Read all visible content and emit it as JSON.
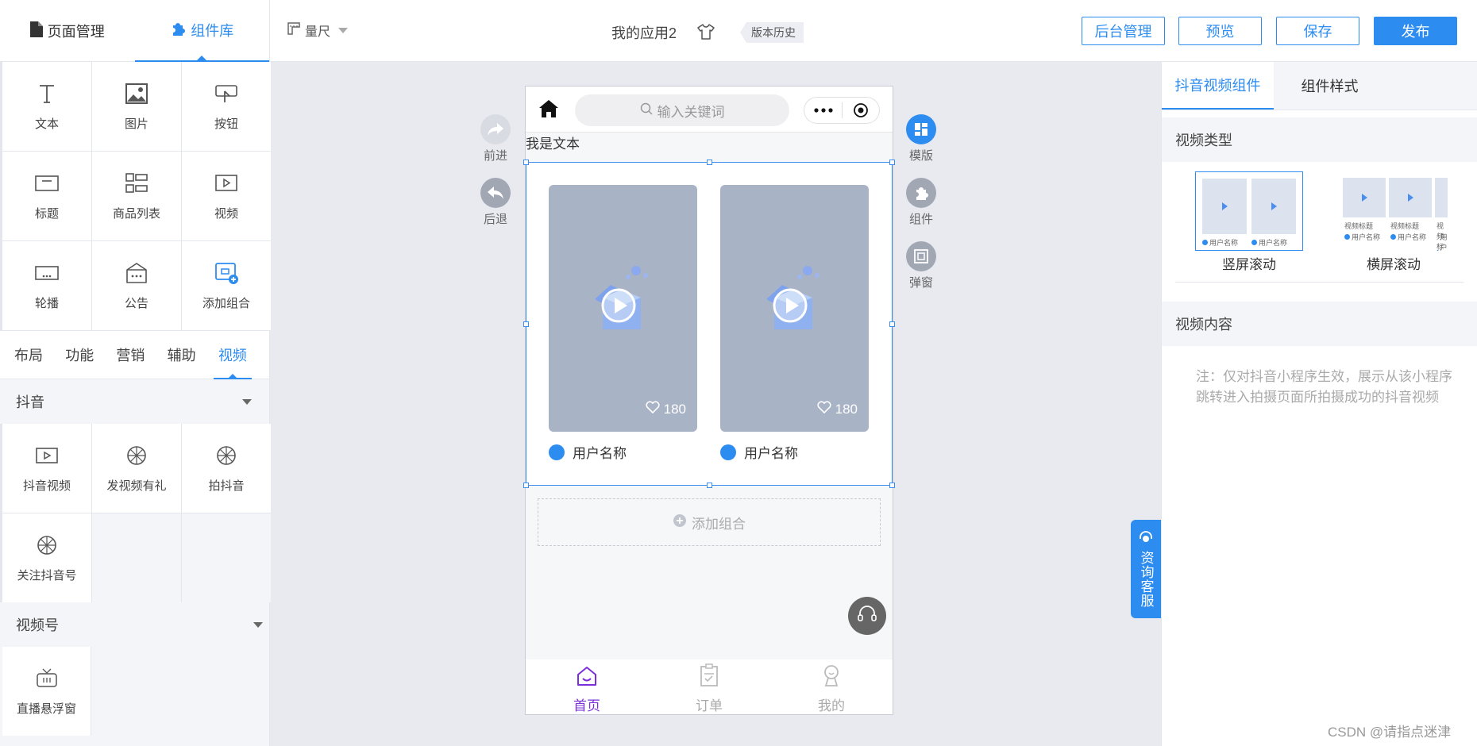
{
  "header": {
    "tabs": [
      {
        "label": "页面管理",
        "icon": "file-icon",
        "active": false
      },
      {
        "label": "组件库",
        "icon": "puzzle-icon",
        "active": true
      }
    ],
    "ruler_label": "量尺",
    "app_title": "我的应用2",
    "version_history": "版本历史",
    "buttons": {
      "admin": "后台管理",
      "preview": "预览",
      "save": "保存",
      "publish": "发布"
    },
    "accent_color": "#2d8cf0"
  },
  "components": {
    "grid": [
      {
        "label": "文本",
        "icon": "text-icon"
      },
      {
        "label": "图片",
        "icon": "image-icon"
      },
      {
        "label": "按钮",
        "icon": "button-icon"
      },
      {
        "label": "标题",
        "icon": "title-icon"
      },
      {
        "label": "商品列表",
        "icon": "product-list-icon"
      },
      {
        "label": "视频",
        "icon": "video-icon"
      },
      {
        "label": "轮播",
        "icon": "carousel-icon"
      },
      {
        "label": "公告",
        "icon": "notice-icon"
      },
      {
        "label": "添加组合",
        "icon": "add-combo-icon"
      }
    ],
    "categories": [
      "布局",
      "功能",
      "营销",
      "辅助",
      "视频"
    ],
    "active_category": "视频",
    "douyin": {
      "title": "抖音",
      "items": [
        {
          "label": "抖音视频",
          "icon": "video-icon"
        },
        {
          "label": "发视频有礼",
          "icon": "aperture-icon"
        },
        {
          "label": "拍抖音",
          "icon": "aperture-icon"
        },
        {
          "label": "关注抖音号",
          "icon": "aperture-icon"
        }
      ]
    },
    "channels": {
      "title": "视频号",
      "items": [
        {
          "label": "直播悬浮窗",
          "icon": "tv-icon"
        }
      ]
    }
  },
  "canvas": {
    "left_actions": {
      "forward": "前进",
      "back": "后退"
    },
    "right_actions": {
      "template": "模版",
      "component": "组件",
      "popup": "弹窗"
    },
    "phone": {
      "search_placeholder": "输入关键词",
      "text_block": "我是文本",
      "videos": [
        {
          "likes": "180",
          "user": "用户名称"
        },
        {
          "likes": "180",
          "user": "用户名称"
        }
      ],
      "add_combo": "添加组合",
      "tabbar": [
        {
          "label": "首页",
          "icon": "home-icon",
          "active": true
        },
        {
          "label": "订单",
          "icon": "order-icon",
          "active": false
        },
        {
          "label": "我的",
          "icon": "user-icon",
          "active": false
        }
      ]
    },
    "consult": "资询客服"
  },
  "right_panel": {
    "tabs": [
      "抖音视频组件",
      "组件样式"
    ],
    "video_type_title": "视频类型",
    "styles": [
      {
        "label": "竖屏滚动",
        "selected": true,
        "thumb_text": "用户名称"
      },
      {
        "label": "横屏滚动",
        "selected": false,
        "thumb_title": "视频标题",
        "thumb_text": "用户名称"
      }
    ],
    "video_content_title": "视频内容",
    "note": "注：仅对抖音小程序生效，展示从该小程序跳转进入拍摄页面所拍摄成功的抖音视频"
  },
  "watermark": "CSDN @请指点迷津"
}
